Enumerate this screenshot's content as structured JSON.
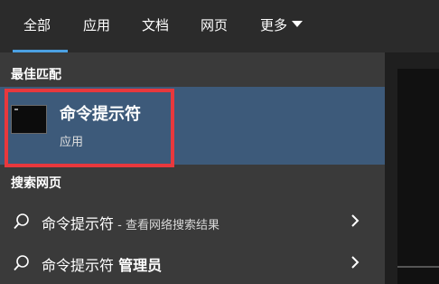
{
  "tabs": [
    {
      "label": "全部",
      "active": true
    },
    {
      "label": "应用"
    },
    {
      "label": "文档"
    },
    {
      "label": "网页"
    },
    {
      "label": "更多"
    }
  ],
  "sections": {
    "best_match": "最佳匹配",
    "web_search": "搜索网页"
  },
  "best_match": {
    "title": "命令提示符",
    "subtitle": "应用",
    "icon": "command-prompt-icon"
  },
  "web_results": [
    {
      "query": "命令提示符",
      "suffix": " - 查看网络搜索结果",
      "icon": "search-icon"
    },
    {
      "query": "命令提示符",
      "bold_suffix": "管理员",
      "icon": "search-icon"
    }
  ],
  "colors": {
    "accent": "#4ba0e2",
    "highlight": "#e8383d",
    "selected_bg": "#3d5a7a"
  }
}
